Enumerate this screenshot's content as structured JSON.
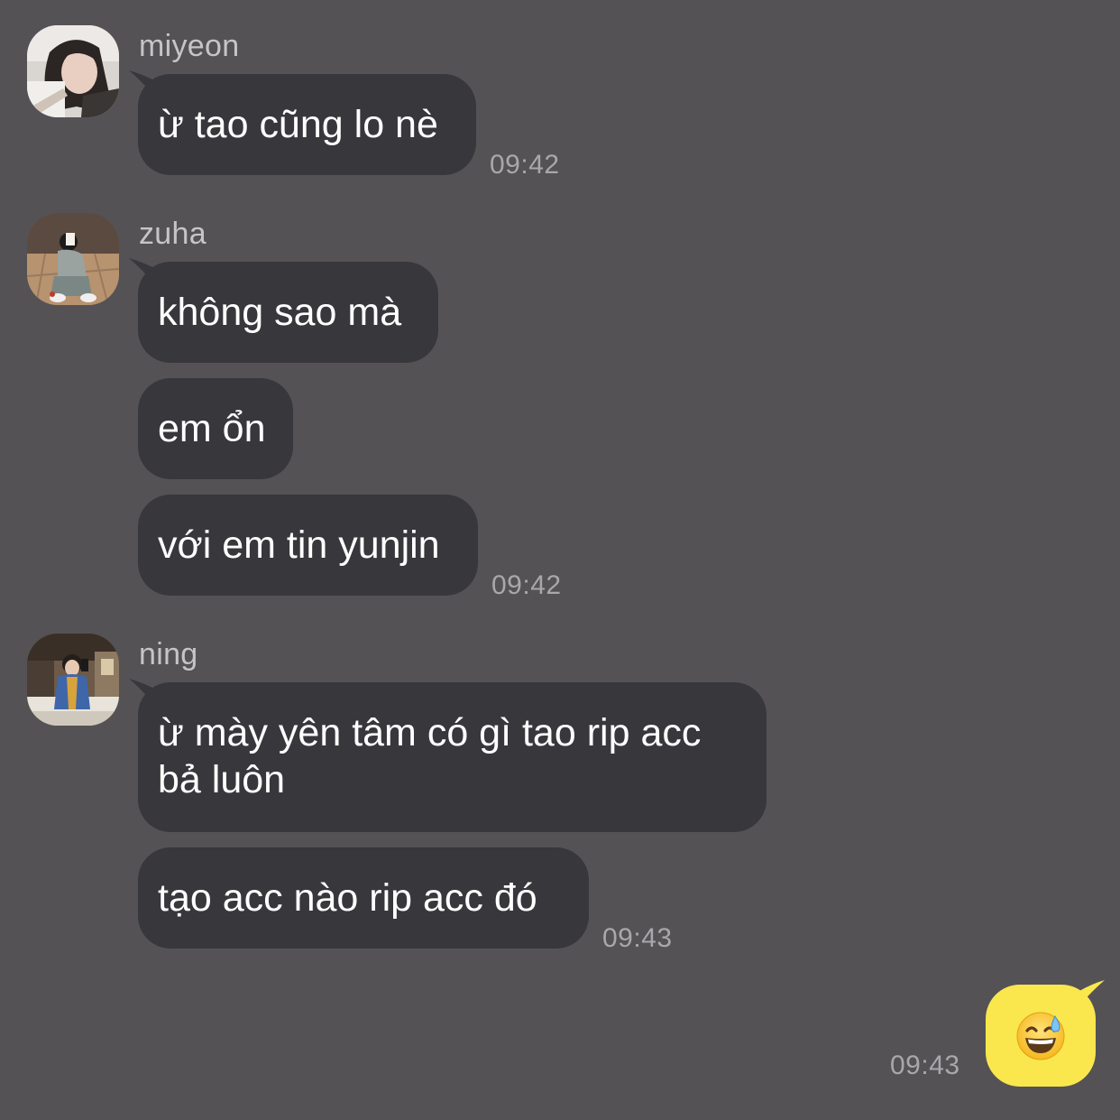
{
  "colors": {
    "background": "#545255",
    "incoming_bubble": "#38373b",
    "outgoing_bubble": "#fae74e",
    "sender_name": "#c6c4c7",
    "timestamp": "#a9a7aa"
  },
  "groups": [
    {
      "sender": "miyeon",
      "avatar_icon": "profile-photo-icon",
      "messages": [
        "ừ tao cũng lo nè"
      ],
      "time": "09:42"
    },
    {
      "sender": "zuha",
      "avatar_icon": "profile-photo-icon",
      "messages": [
        "không sao mà",
        "em ổn",
        "với em tin yunjin"
      ],
      "time": "09:42"
    },
    {
      "sender": "ning",
      "avatar_icon": "profile-photo-icon",
      "messages": [
        "ừ mày yên tâm có gì tao rip acc bả luôn",
        "tạo acc nào rip acc đó"
      ],
      "time": "09:43"
    }
  ],
  "outgoing": {
    "emoji": "😅",
    "emoji_icon": "grinning-face-with-sweat-icon",
    "time": "09:43"
  }
}
